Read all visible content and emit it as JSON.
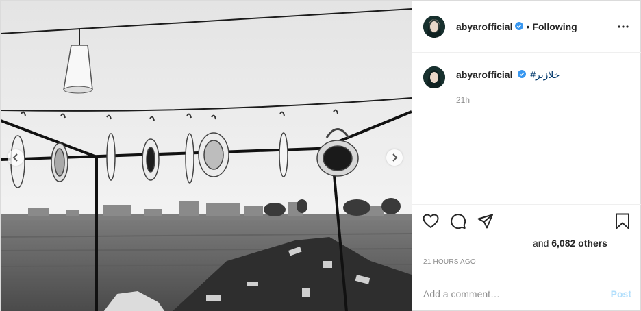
{
  "post": {
    "author": {
      "username": "abyarofficial",
      "verified": true,
      "follow_status": "Following"
    },
    "caption": {
      "username": "abyarofficial",
      "hashtag": "خلازیر#",
      "time": "21h"
    },
    "likes": {
      "prefix": "and",
      "count": "6,082 others"
    },
    "timestamp": "21 HOURS AGO",
    "comment": {
      "placeholder": "Add a comment…",
      "post_label": "Post"
    },
    "icons": {
      "more": "more-options-icon",
      "like": "heart-icon",
      "comment": "comment-icon",
      "share": "share-icon",
      "save": "bookmark-icon",
      "prev": "chevron-left-icon",
      "next": "chevron-right-icon",
      "verified": "verified-badge-icon"
    },
    "colors": {
      "verified": "#3897f0",
      "link": "#00376b",
      "secondary_text": "#8e8e8e",
      "post_button": "#b2dffc"
    }
  }
}
